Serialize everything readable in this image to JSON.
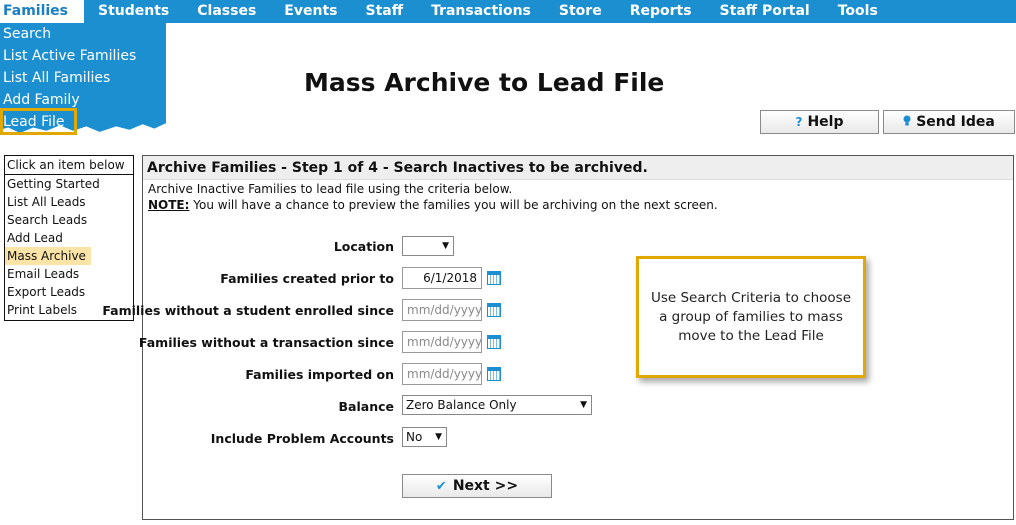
{
  "topnav": {
    "tabs": [
      "Families",
      "Students",
      "Classes",
      "Events",
      "Staff",
      "Transactions",
      "Store",
      "Reports",
      "Staff Portal",
      "Tools"
    ]
  },
  "families_menu": {
    "items": [
      "Search",
      "List Active Families",
      "List All Families",
      "Add Family",
      "Lead File"
    ]
  },
  "page": {
    "title": "Mass Archive to Lead File"
  },
  "toolbar": {
    "help_label": "Help",
    "help_icon": "?",
    "send_idea_label": "Send Idea",
    "send_idea_icon": "lightbulb-icon"
  },
  "left_menu": {
    "header": "Click an item below",
    "items": [
      "Getting Started",
      "List All Leads",
      "Search Leads",
      "Add Lead",
      "Mass Archive",
      "Email Leads",
      "Export Leads",
      "Print Labels"
    ],
    "selected": "Mass Archive"
  },
  "panel": {
    "header": "Archive Families - Step 1 of 4 - Search Inactives to be archived.",
    "intro_line": "Archive Inactive Families to lead file using the criteria below.",
    "note_label": "NOTE:",
    "note_text": " You will have a chance to preview the families you will be archiving on the next screen."
  },
  "form": {
    "location_label": "Location",
    "location_value": "",
    "created_prior_label": "Families created prior to",
    "created_prior_value": "6/1/2018",
    "no_student_label": "Families without a student enrolled since",
    "no_transaction_label": "Families without a transaction since",
    "imported_on_label": "Families imported on",
    "date_placeholder": "mm/dd/yyyy",
    "balance_label": "Balance",
    "balance_value": "Zero Balance Only",
    "problem_accounts_label": "Include Problem Accounts",
    "problem_accounts_value": "No",
    "next_label": "Next >>"
  },
  "callout": {
    "text": "Use Search Criteria to choose a group of families to mass move to the Lead File"
  },
  "colors": {
    "nav_blue": "#1c8fd0",
    "highlight_gold": "#e0a800",
    "selected_item": "#fce3a6"
  }
}
